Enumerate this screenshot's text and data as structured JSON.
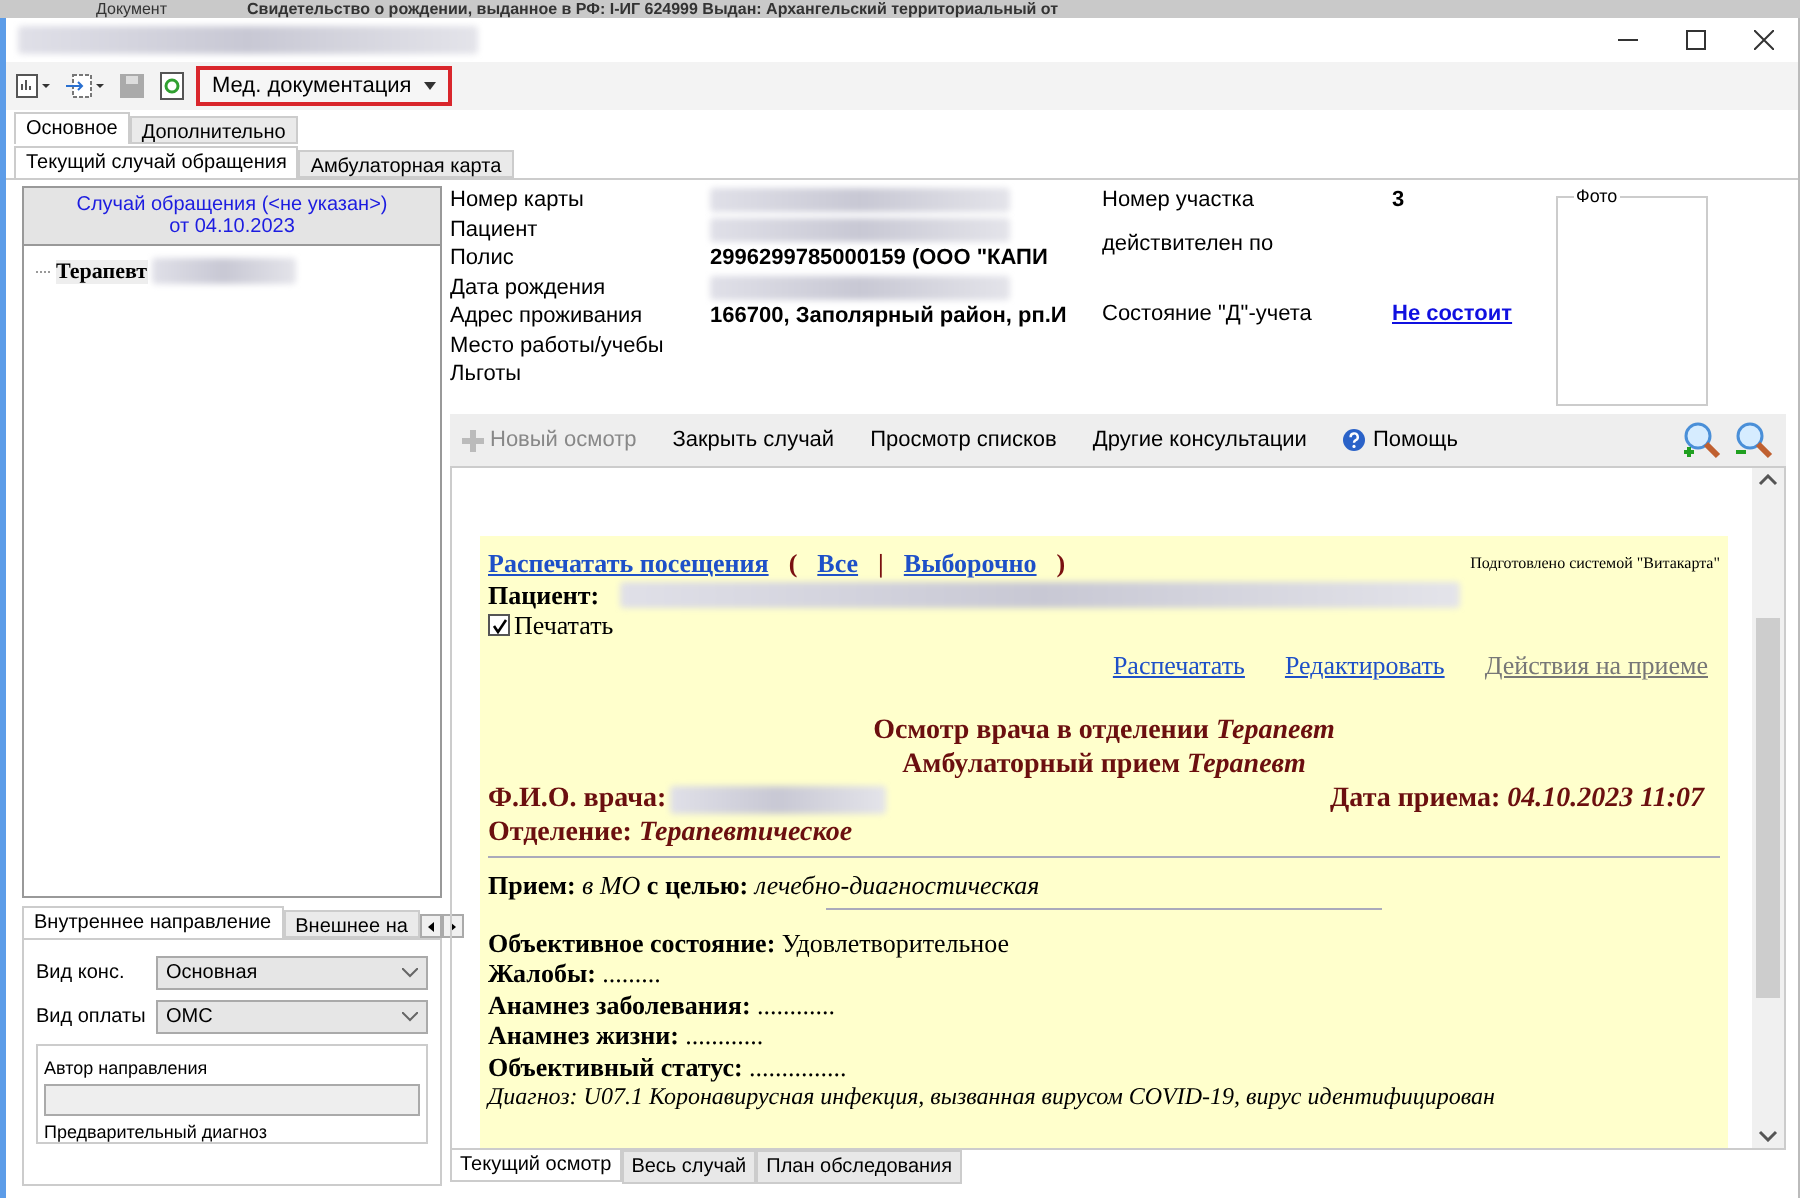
{
  "background_window": {
    "label": "Документ",
    "value": "Свидетельство о рождении, выданное в РФ: I-ИГ 624999 Выдан: Архангельский территориальный от"
  },
  "toolbar": {
    "menu_button": "Мед. документация"
  },
  "tabs": [
    {
      "label": "Основное",
      "selected": true
    },
    {
      "label": "Дополнительно",
      "selected": false
    }
  ],
  "subtabs": [
    {
      "label": "Текущий случай обращения",
      "selected": true
    },
    {
      "label": "Амбулаторная карта",
      "selected": false
    }
  ],
  "case_header": {
    "title": "Случай обращения (<не указан>)",
    "date": "от 04.10.2023"
  },
  "tree": [
    {
      "label": "Терапевт",
      "redacted": true
    }
  ],
  "direction_tabs": [
    {
      "label": "Внутреннее направление",
      "selected": true
    },
    {
      "label": "Внешнее на",
      "selected": false
    }
  ],
  "direction_fields": [
    {
      "label": "Вид конс.",
      "value": "Основная"
    },
    {
      "label": "Вид оплаты",
      "value": "ОМС"
    }
  ],
  "direction_group": {
    "author_label": "Автор направления",
    "next_label": "Предварительный диагноз"
  },
  "patient_fields": [
    {
      "label": "Номер карты",
      "redacted": true
    },
    {
      "label": "Пациент",
      "redacted": true
    },
    {
      "label": "Полис",
      "value": "2996299785000159 (ООО \"КАПИ",
      "redacted": false
    },
    {
      "label": "Дата рождения",
      "redacted": true
    },
    {
      "label": "Адрес проживания",
      "value": "166700, Заполярный район, рп.И",
      "redacted": false
    },
    {
      "label": "Место работы/учебы",
      "redacted": false
    },
    {
      "label": "Льготы",
      "redacted": false
    }
  ],
  "extra_fields": [
    {
      "label": "Номер участка",
      "value": "3",
      "kind": "text"
    },
    {
      "label": "действителен по",
      "kind": "text"
    },
    {
      "label": "Состояние \"Д\"-учета",
      "value": "Не состоит",
      "kind": "link"
    }
  ],
  "photo": {
    "label": "Фото"
  },
  "doc_toolbar": [
    {
      "label": "Новый осмотр",
      "disabled": true
    },
    {
      "label": "Закрыть случай",
      "disabled": false
    },
    {
      "label": "Просмотр списков",
      "disabled": false
    },
    {
      "label": "Другие консультации",
      "disabled": false
    },
    {
      "label": "Помощь",
      "disabled": false
    }
  ],
  "document": {
    "print_links": [
      {
        "text": "Распечатать посещения",
        "kind": "link"
      },
      {
        "text": "(",
        "kind": "mark"
      },
      {
        "text": "Все",
        "kind": "link"
      },
      {
        "text": "|",
        "kind": "mark"
      },
      {
        "text": "Выборочно",
        "kind": "link"
      },
      {
        "text": ")",
        "kind": "mark"
      }
    ],
    "system_note": "Подготовлено системой \"Витакарта\"",
    "patient_label": "Пациент:",
    "print_checkbox": {
      "label": "Печатать",
      "checked": true
    },
    "actions": [
      {
        "label": "Распечатать",
        "disabled": false
      },
      {
        "label": "Редактировать",
        "disabled": false
      },
      {
        "label": "Действия на приеме",
        "disabled": true
      }
    ],
    "titles": [
      "Осмотр врача в отделении *Терапевт*",
      "Амбулаторный прием *Терапевт*"
    ],
    "doctor_label": "Ф.И.О. врача:",
    "date_line": "Дата приема: *04.10.2023 11:07*",
    "department": "Отделение: *Терапевтическое*",
    "purpose": "**Прием:** *в МО* **с целью:** *лечебно-диагностическая*",
    "body": [
      "**Объективное состояние:** Удовлетворительное",
      "**Жалобы:** .........",
      "**Анамнез заболевания:** ............",
      "**Анамнез жизни:** ............",
      "**Объективный статус:** ..............."
    ],
    "diagnosis": "*Диагноз: U07.1 Коронавирусная инфекция, вызванная вирусом COVID-19, вирус идентифицирован*"
  },
  "bottom_tabs": [
    {
      "label": "Текущий осмотр",
      "selected": true
    },
    {
      "label": "Весь случай",
      "selected": false
    },
    {
      "label": "План обследования",
      "selected": false
    }
  ]
}
